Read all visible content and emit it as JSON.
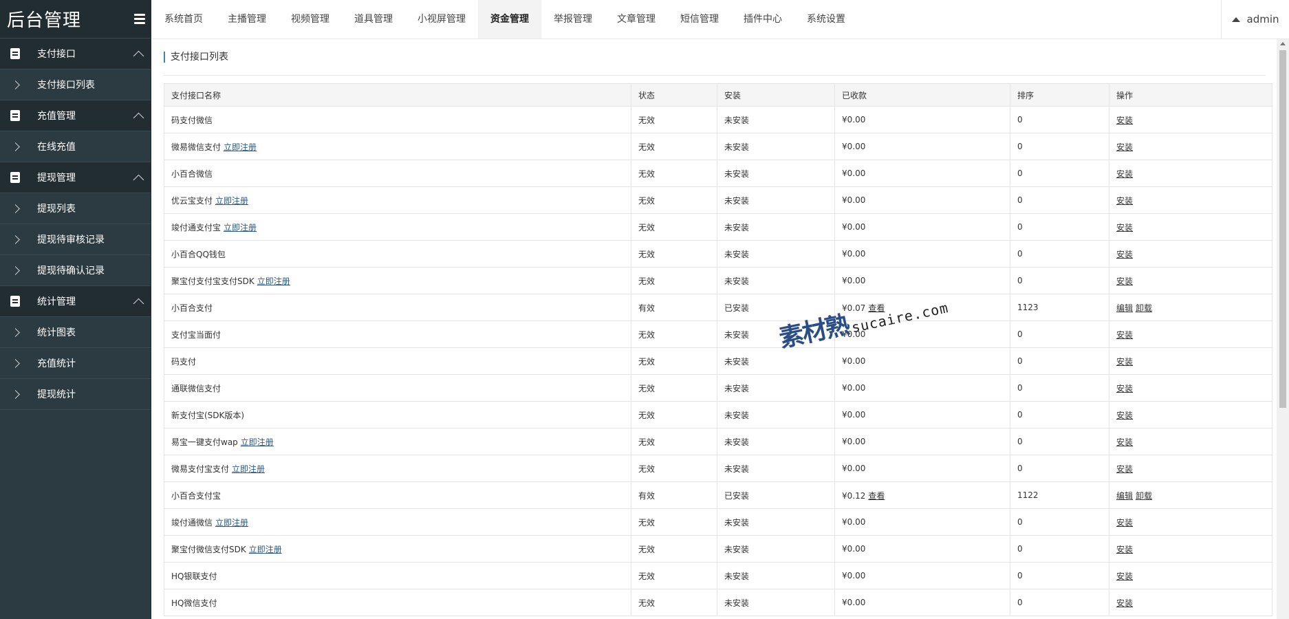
{
  "app": {
    "title": "后台管理",
    "user": "admin"
  },
  "sidebar": {
    "groups": [
      {
        "label": "支付接口",
        "items": [
          "支付接口列表"
        ]
      },
      {
        "label": "充值管理",
        "items": [
          "在线充值"
        ]
      },
      {
        "label": "提现管理",
        "items": [
          "提现列表",
          "提现待审核记录",
          "提现待确认记录"
        ]
      },
      {
        "label": "统计管理",
        "items": [
          "统计图表",
          "充值统计",
          "提现统计"
        ]
      }
    ]
  },
  "nav": {
    "tabs": [
      "系统首页",
      "主播管理",
      "视频管理",
      "道具管理",
      "小视屏管理",
      "资金管理",
      "举报管理",
      "文章管理",
      "短信管理",
      "插件中心",
      "系统设置"
    ],
    "active": "资金管理"
  },
  "main": {
    "title": "支付接口列表",
    "columns": [
      "支付接口名称",
      "状态",
      "安装",
      "已收款",
      "排序",
      "操作"
    ],
    "rows": [
      {
        "name": "码支付微信",
        "register": "",
        "status": "无效",
        "install": "未安装",
        "received": "¥0.00",
        "view": "",
        "sort": "0",
        "actions": [
          "安装"
        ]
      },
      {
        "name": "微易微信支付",
        "register": "立即注册",
        "status": "无效",
        "install": "未安装",
        "received": "¥0.00",
        "view": "",
        "sort": "0",
        "actions": [
          "安装"
        ]
      },
      {
        "name": "小百合微信",
        "register": "",
        "status": "无效",
        "install": "未安装",
        "received": "¥0.00",
        "view": "",
        "sort": "0",
        "actions": [
          "安装"
        ]
      },
      {
        "name": "优云宝支付",
        "register": "立即注册",
        "status": "无效",
        "install": "未安装",
        "received": "¥0.00",
        "view": "",
        "sort": "0",
        "actions": [
          "安装"
        ]
      },
      {
        "name": "竣付通支付宝",
        "register": "立即注册",
        "status": "无效",
        "install": "未安装",
        "received": "¥0.00",
        "view": "",
        "sort": "0",
        "actions": [
          "安装"
        ]
      },
      {
        "name": "小百合QQ钱包",
        "register": "",
        "status": "无效",
        "install": "未安装",
        "received": "¥0.00",
        "view": "",
        "sort": "0",
        "actions": [
          "安装"
        ]
      },
      {
        "name": "聚宝付支付宝支付SDK",
        "register": "立即注册",
        "status": "无效",
        "install": "未安装",
        "received": "¥0.00",
        "view": "",
        "sort": "0",
        "actions": [
          "安装"
        ]
      },
      {
        "name": "小百合支付",
        "register": "",
        "status": "有效",
        "install": "已安装",
        "received": "¥0.07",
        "view": "查看",
        "sort": "1123",
        "actions": [
          "编辑",
          "卸载"
        ]
      },
      {
        "name": "支付宝当面付",
        "register": "",
        "status": "无效",
        "install": "未安装",
        "received": "¥0.00",
        "view": "",
        "sort": "0",
        "actions": [
          "安装"
        ]
      },
      {
        "name": "码支付",
        "register": "",
        "status": "无效",
        "install": "未安装",
        "received": "¥0.00",
        "view": "",
        "sort": "0",
        "actions": [
          "安装"
        ]
      },
      {
        "name": "通联微信支付",
        "register": "",
        "status": "无效",
        "install": "未安装",
        "received": "¥0.00",
        "view": "",
        "sort": "0",
        "actions": [
          "安装"
        ]
      },
      {
        "name": "新支付宝(SDK版本)",
        "register": "",
        "status": "无效",
        "install": "未安装",
        "received": "¥0.00",
        "view": "",
        "sort": "0",
        "actions": [
          "安装"
        ]
      },
      {
        "name": "易宝一键支付wap",
        "register": "立即注册",
        "status": "无效",
        "install": "未安装",
        "received": "¥0.00",
        "view": "",
        "sort": "0",
        "actions": [
          "安装"
        ]
      },
      {
        "name": "微易支付宝支付",
        "register": "立即注册",
        "status": "无效",
        "install": "未安装",
        "received": "¥0.00",
        "view": "",
        "sort": "0",
        "actions": [
          "安装"
        ]
      },
      {
        "name": "小百合支付宝",
        "register": "",
        "status": "有效",
        "install": "已安装",
        "received": "¥0.12",
        "view": "查看",
        "sort": "1122",
        "actions": [
          "编辑",
          "卸载"
        ]
      },
      {
        "name": "竣付通微信",
        "register": "立即注册",
        "status": "无效",
        "install": "未安装",
        "received": "¥0.00",
        "view": "",
        "sort": "0",
        "actions": [
          "安装"
        ]
      },
      {
        "name": "聚宝付微信支付SDK",
        "register": "立即注册",
        "status": "无效",
        "install": "未安装",
        "received": "¥0.00",
        "view": "",
        "sort": "0",
        "actions": [
          "安装"
        ]
      },
      {
        "name": "HQ银联支付",
        "register": "",
        "status": "无效",
        "install": "未安装",
        "received": "¥0.00",
        "view": "",
        "sort": "0",
        "actions": [
          "安装"
        ]
      },
      {
        "name": "HQ微信支付",
        "register": "",
        "status": "无效",
        "install": "未安装",
        "received": "¥0.00",
        "view": "",
        "sort": "0",
        "actions": [
          "安装"
        ]
      }
    ]
  },
  "watermark": {
    "logo": "素材熟",
    "url": "sucaire.com"
  },
  "colors": {
    "sidebar_bg": "#2c3b41",
    "sidebar_group_bg": "#222d32",
    "accent": "#3a87ad",
    "link": "#2a5a8a"
  }
}
